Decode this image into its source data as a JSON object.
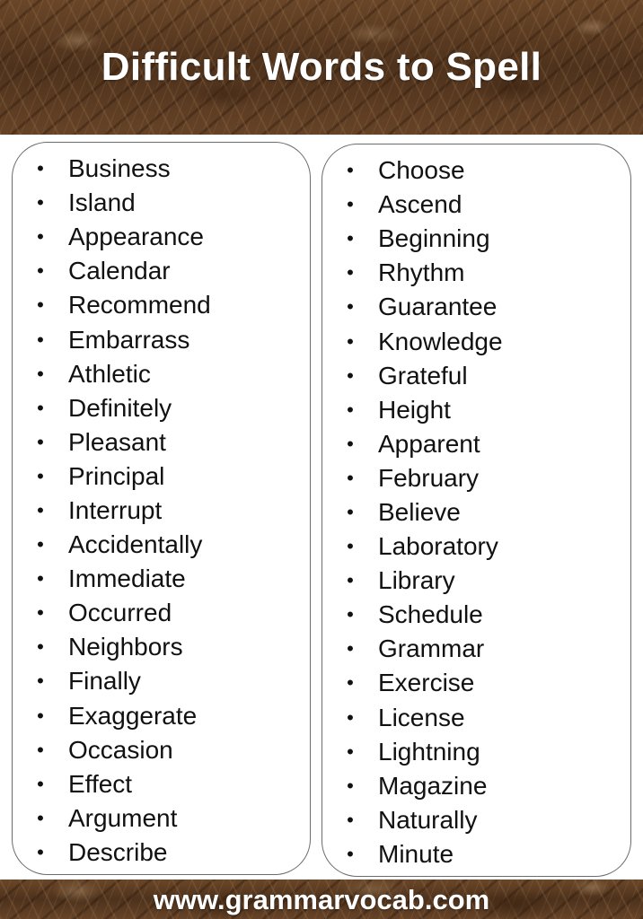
{
  "header": {
    "title": "Difficult Words to Spell"
  },
  "footer": {
    "website": "www.grammarvocab.com"
  },
  "bullet_glyph": "•",
  "colors": {
    "banner_texture": "#5a3b22",
    "banner_text": "#ffffff",
    "card_border": "#6b6b6b",
    "text": "#111111"
  },
  "left_column": {
    "words": [
      "Business",
      "Island",
      "Appearance",
      "Calendar",
      "Recommend",
      "Embarrass",
      "Athletic",
      "Definitely",
      "Pleasant",
      "Principal",
      "Interrupt",
      "Accidentally",
      "Immediate",
      "Occurred",
      "Neighbors",
      "Finally",
      "Exaggerate",
      "Occasion",
      "Effect",
      "Argument",
      "Describe"
    ]
  },
  "right_column": {
    "words": [
      "Choose",
      "Ascend",
      "Beginning",
      "Rhythm",
      "Guarantee",
      "Knowledge",
      "Grateful",
      "Height",
      "Apparent",
      "February",
      "Believe",
      "Laboratory",
      "Library",
      "Schedule",
      "Grammar",
      "Exercise",
      "License",
      "Lightning",
      "Magazine",
      "Naturally",
      "Minute"
    ]
  }
}
